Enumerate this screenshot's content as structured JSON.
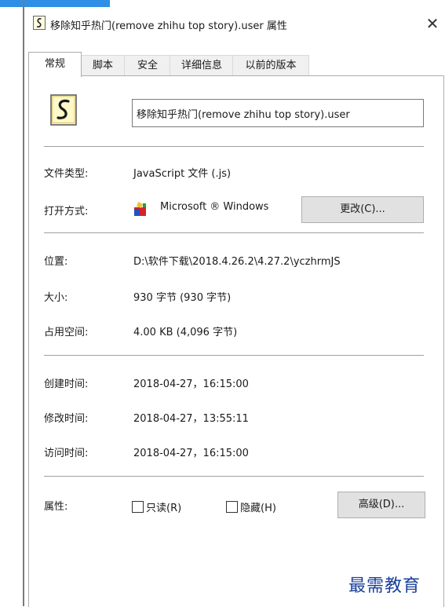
{
  "window": {
    "title": "移除知乎热门(remove zhihu top story).user 属性",
    "close_symbol": "✕"
  },
  "tabs": [
    {
      "label": "常规",
      "active": true
    },
    {
      "label": "脚本"
    },
    {
      "label": "安全"
    },
    {
      "label": "详细信息"
    },
    {
      "label": "以前的版本"
    }
  ],
  "general": {
    "file_name": "移除知乎热门(remove zhihu top story).user",
    "file_type_label": "文件类型:",
    "file_type_value": "JavaScript 文件 (.js)",
    "opens_with_label": "打开方式:",
    "opens_with_value": "Microsoft ® Windows",
    "change_button": "更改(C)...",
    "location_label": "位置:",
    "location_value": "D:\\软件下载\\2018.4.26.2\\4.27.2\\yczhrmJS",
    "size_label": "大小:",
    "size_value": "930 字节 (930 字节)",
    "size_on_disk_label": "占用空间:",
    "size_on_disk_value": "4.00 KB (4,096 字节)",
    "created_label": "创建时间:",
    "created_value": "2018-04-27，16:15:00",
    "modified_label": "修改时间:",
    "modified_value": "2018-04-27，13:55:11",
    "accessed_label": "访问时间:",
    "accessed_value": "2018-04-27，16:15:00",
    "attributes_label": "属性:",
    "readonly_label": "只读(R)",
    "readonly_checked": false,
    "hidden_label": "隐藏(H)",
    "hidden_checked": false,
    "advanced_button": "高级(D)..."
  },
  "icons": {
    "file_icon": "script-file-icon",
    "app_icon": "windows-script-host-icon"
  },
  "colors": {
    "accent": "#2f8ee6",
    "watermark": "#1a3f9c"
  },
  "watermark": "最需教育"
}
